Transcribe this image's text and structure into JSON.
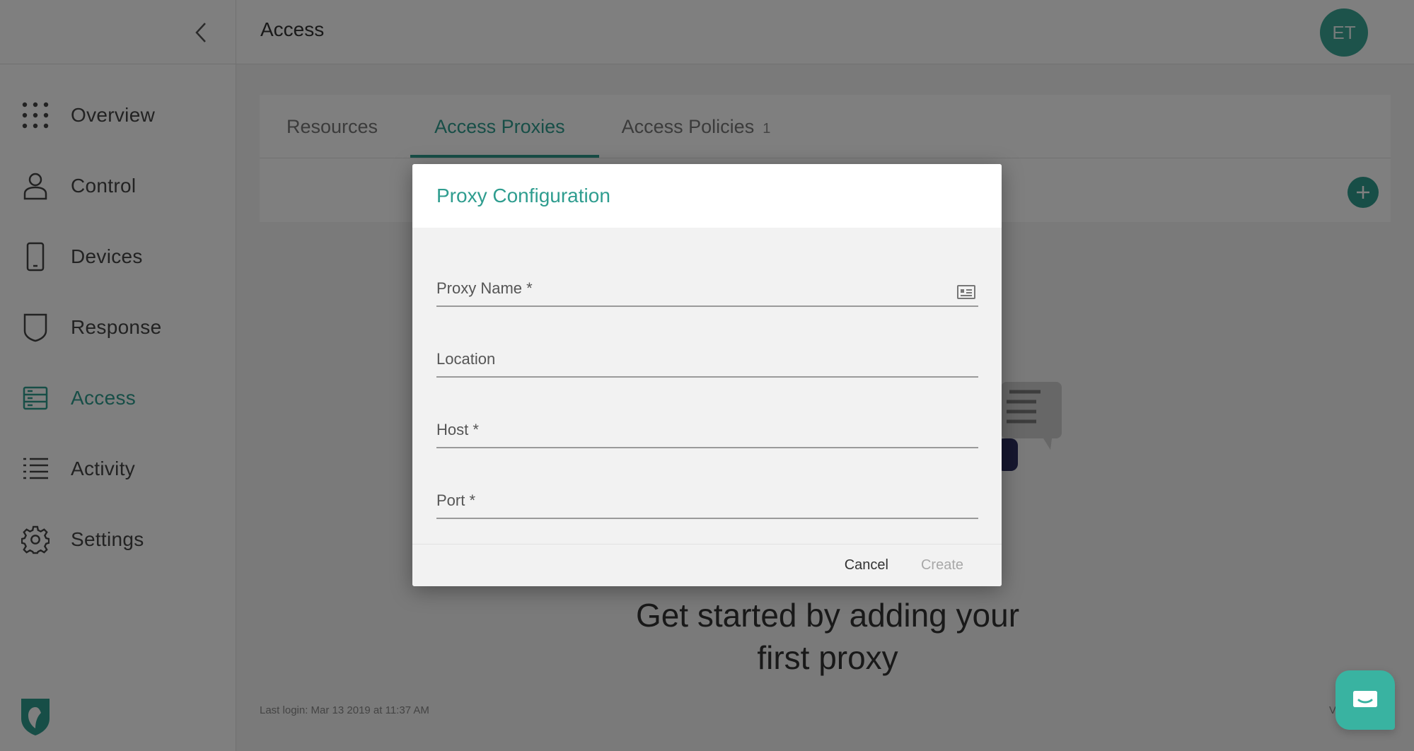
{
  "app": {
    "header_title": "Access",
    "avatar_initials": "ET",
    "accent_color": "#2f9d8f"
  },
  "sidebar": {
    "items": [
      {
        "label": "Overview",
        "icon": "grid-dots-icon",
        "active": false
      },
      {
        "label": "Control",
        "icon": "user-icon",
        "active": false
      },
      {
        "label": "Devices",
        "icon": "phone-icon",
        "active": false
      },
      {
        "label": "Response",
        "icon": "shield-icon",
        "active": false
      },
      {
        "label": "Access",
        "icon": "server-rack-icon",
        "active": true
      },
      {
        "label": "Activity",
        "icon": "list-icon",
        "active": false
      },
      {
        "label": "Settings",
        "icon": "gear-icon",
        "active": false
      }
    ]
  },
  "tabs": [
    {
      "label": "Resources",
      "active": false
    },
    {
      "label": "Access Proxies",
      "active": true
    },
    {
      "label": "Access Policies",
      "count": "1",
      "active": false
    }
  ],
  "main": {
    "empty_text_line1": "Get started by adding your",
    "empty_text_line2": "first proxy",
    "last_login": "Last login: Mar 13 2019 at 11:37 AM",
    "version_partial": "Vers"
  },
  "modal": {
    "title": "Proxy Configuration",
    "fields": [
      {
        "placeholder": "Proxy Name *",
        "value": ""
      },
      {
        "placeholder": "Location",
        "value": ""
      },
      {
        "placeholder": "Host *",
        "value": ""
      },
      {
        "placeholder": "Port *",
        "value": ""
      }
    ],
    "cancel_label": "Cancel",
    "create_label": "Create"
  }
}
